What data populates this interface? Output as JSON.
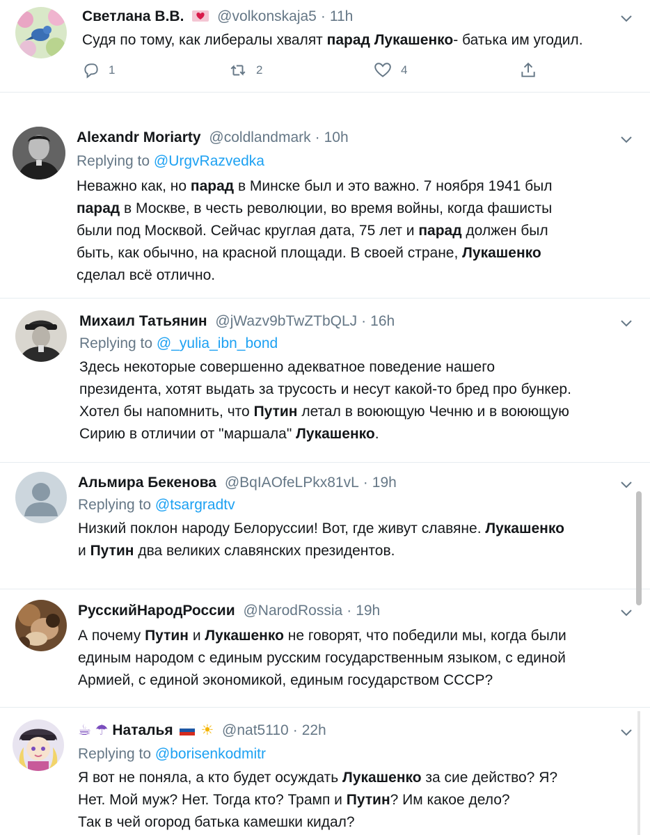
{
  "tweets": [
    {
      "name": "Светлана В.В.",
      "handle": "@volkonskaja5",
      "time": "11h",
      "text_html": "Судя по тому, как либералы хвалят <b>парад</b> <b>Лукашенко</b>- батька им угодил.",
      "actions": {
        "reply_count": "1",
        "retweet_count": "2",
        "like_count": "4"
      }
    },
    {
      "name": "Alexandr Moriarty",
      "handle": "@coldlandmark",
      "time": "10h",
      "replying_prefix": "Replying to",
      "replying_to": "@UrgvRazvedka",
      "text_html": "Неважно как, но <b>парад</b> в Минске был и это важно. 7 ноября 1941 был<br><b>парад</b> в Москве, в честь революции, во время войны, когда фашисты<br>были под Москвой. Сейчас круглая дата, 75 лет и <b>парад</b> должен был<br>быть, как обычно, на красной площади. В своей стране, <b>Лукашенко</b><br>сделал всё отлично."
    },
    {
      "name": "Михаил Татьянин",
      "handle": "@jWazv9bTwZTbQLJ",
      "time": "16h",
      "replying_prefix": "Replying to",
      "replying_to": "@_yulia_ibn_bond",
      "text_html": "Здесь некоторые совершенно адекватное поведение нашего<br>президента, хотят выдать за трусость и несут какой-то бред про бункер.<br>Хотел бы напомнить, что <b>Путин</b> летал в воюющую Чечню и в воюющую<br>Сирию в отличии от \"маршала\" <b>Лукашенко</b>."
    },
    {
      "name": "Альмира Бекенова",
      "handle": "@BqIAOfeLPkx81vL",
      "time": "19h",
      "replying_prefix": "Replying to",
      "replying_to": "@tsargradtv",
      "text_html": "Низкий поклон народу Белоруссии! Вот, где живут славяне. <b>Лукашенко</b><br>и <b>Путин</b> два великих славянских президентов."
    },
    {
      "name": "РусскийНародРоссии",
      "handle": "@NarodRossia",
      "time": "19h",
      "text_html": "А почему <b>Путин</b> и <b>Лукашенко</b> не говорят, что победили мы, когда были<br>единым народом с единым русским государственным языком, с единой<br>Армией, с единой экономикой, единым государством СССР?"
    },
    {
      "name": "Наталья",
      "name_emoji_prefix": "☕ ☂",
      "name_emoji_suffix": "☀",
      "handle": "@nat5110",
      "time": "22h",
      "replying_prefix": "Replying to",
      "replying_to": "@borisenkodmitr",
      "text_html": "Я вот не поняла, а кто будет осуждать <b>Лукашенко</b> за сие действо? Я?<br>Нет. Мой муж? Нет. Тогда кто? Трамп и <b>Путин</b>? Им какое дело?<br>Так в чей огород батька камешки кидал?"
    }
  ],
  "colors": {
    "text": "#14171a",
    "secondary": "#657786",
    "link": "#1da1f2",
    "divider": "#e6ecf0"
  },
  "icons": [
    "reply-icon",
    "retweet-icon",
    "like-icon",
    "share-icon",
    "chevron-down-icon",
    "heart-emoji-icon",
    "russia-flag-icon"
  ]
}
